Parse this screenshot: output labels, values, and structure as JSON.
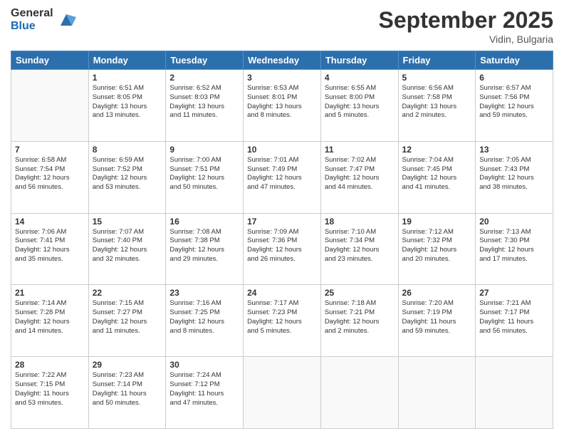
{
  "header": {
    "logo_general": "General",
    "logo_blue": "Blue",
    "month_title": "September 2025",
    "location": "Vidin, Bulgaria"
  },
  "days_of_week": [
    "Sunday",
    "Monday",
    "Tuesday",
    "Wednesday",
    "Thursday",
    "Friday",
    "Saturday"
  ],
  "weeks": [
    [
      {
        "day": "",
        "info": ""
      },
      {
        "day": "1",
        "info": "Sunrise: 6:51 AM\nSunset: 8:05 PM\nDaylight: 13 hours\nand 13 minutes."
      },
      {
        "day": "2",
        "info": "Sunrise: 6:52 AM\nSunset: 8:03 PM\nDaylight: 13 hours\nand 11 minutes."
      },
      {
        "day": "3",
        "info": "Sunrise: 6:53 AM\nSunset: 8:01 PM\nDaylight: 13 hours\nand 8 minutes."
      },
      {
        "day": "4",
        "info": "Sunrise: 6:55 AM\nSunset: 8:00 PM\nDaylight: 13 hours\nand 5 minutes."
      },
      {
        "day": "5",
        "info": "Sunrise: 6:56 AM\nSunset: 7:58 PM\nDaylight: 13 hours\nand 2 minutes."
      },
      {
        "day": "6",
        "info": "Sunrise: 6:57 AM\nSunset: 7:56 PM\nDaylight: 12 hours\nand 59 minutes."
      }
    ],
    [
      {
        "day": "7",
        "info": "Sunrise: 6:58 AM\nSunset: 7:54 PM\nDaylight: 12 hours\nand 56 minutes."
      },
      {
        "day": "8",
        "info": "Sunrise: 6:59 AM\nSunset: 7:52 PM\nDaylight: 12 hours\nand 53 minutes."
      },
      {
        "day": "9",
        "info": "Sunrise: 7:00 AM\nSunset: 7:51 PM\nDaylight: 12 hours\nand 50 minutes."
      },
      {
        "day": "10",
        "info": "Sunrise: 7:01 AM\nSunset: 7:49 PM\nDaylight: 12 hours\nand 47 minutes."
      },
      {
        "day": "11",
        "info": "Sunrise: 7:02 AM\nSunset: 7:47 PM\nDaylight: 12 hours\nand 44 minutes."
      },
      {
        "day": "12",
        "info": "Sunrise: 7:04 AM\nSunset: 7:45 PM\nDaylight: 12 hours\nand 41 minutes."
      },
      {
        "day": "13",
        "info": "Sunrise: 7:05 AM\nSunset: 7:43 PM\nDaylight: 12 hours\nand 38 minutes."
      }
    ],
    [
      {
        "day": "14",
        "info": "Sunrise: 7:06 AM\nSunset: 7:41 PM\nDaylight: 12 hours\nand 35 minutes."
      },
      {
        "day": "15",
        "info": "Sunrise: 7:07 AM\nSunset: 7:40 PM\nDaylight: 12 hours\nand 32 minutes."
      },
      {
        "day": "16",
        "info": "Sunrise: 7:08 AM\nSunset: 7:38 PM\nDaylight: 12 hours\nand 29 minutes."
      },
      {
        "day": "17",
        "info": "Sunrise: 7:09 AM\nSunset: 7:36 PM\nDaylight: 12 hours\nand 26 minutes."
      },
      {
        "day": "18",
        "info": "Sunrise: 7:10 AM\nSunset: 7:34 PM\nDaylight: 12 hours\nand 23 minutes."
      },
      {
        "day": "19",
        "info": "Sunrise: 7:12 AM\nSunset: 7:32 PM\nDaylight: 12 hours\nand 20 minutes."
      },
      {
        "day": "20",
        "info": "Sunrise: 7:13 AM\nSunset: 7:30 PM\nDaylight: 12 hours\nand 17 minutes."
      }
    ],
    [
      {
        "day": "21",
        "info": "Sunrise: 7:14 AM\nSunset: 7:28 PM\nDaylight: 12 hours\nand 14 minutes."
      },
      {
        "day": "22",
        "info": "Sunrise: 7:15 AM\nSunset: 7:27 PM\nDaylight: 12 hours\nand 11 minutes."
      },
      {
        "day": "23",
        "info": "Sunrise: 7:16 AM\nSunset: 7:25 PM\nDaylight: 12 hours\nand 8 minutes."
      },
      {
        "day": "24",
        "info": "Sunrise: 7:17 AM\nSunset: 7:23 PM\nDaylight: 12 hours\nand 5 minutes."
      },
      {
        "day": "25",
        "info": "Sunrise: 7:18 AM\nSunset: 7:21 PM\nDaylight: 12 hours\nand 2 minutes."
      },
      {
        "day": "26",
        "info": "Sunrise: 7:20 AM\nSunset: 7:19 PM\nDaylight: 11 hours\nand 59 minutes."
      },
      {
        "day": "27",
        "info": "Sunrise: 7:21 AM\nSunset: 7:17 PM\nDaylight: 11 hours\nand 56 minutes."
      }
    ],
    [
      {
        "day": "28",
        "info": "Sunrise: 7:22 AM\nSunset: 7:15 PM\nDaylight: 11 hours\nand 53 minutes."
      },
      {
        "day": "29",
        "info": "Sunrise: 7:23 AM\nSunset: 7:14 PM\nDaylight: 11 hours\nand 50 minutes."
      },
      {
        "day": "30",
        "info": "Sunrise: 7:24 AM\nSunset: 7:12 PM\nDaylight: 11 hours\nand 47 minutes."
      },
      {
        "day": "",
        "info": ""
      },
      {
        "day": "",
        "info": ""
      },
      {
        "day": "",
        "info": ""
      },
      {
        "day": "",
        "info": ""
      }
    ]
  ]
}
